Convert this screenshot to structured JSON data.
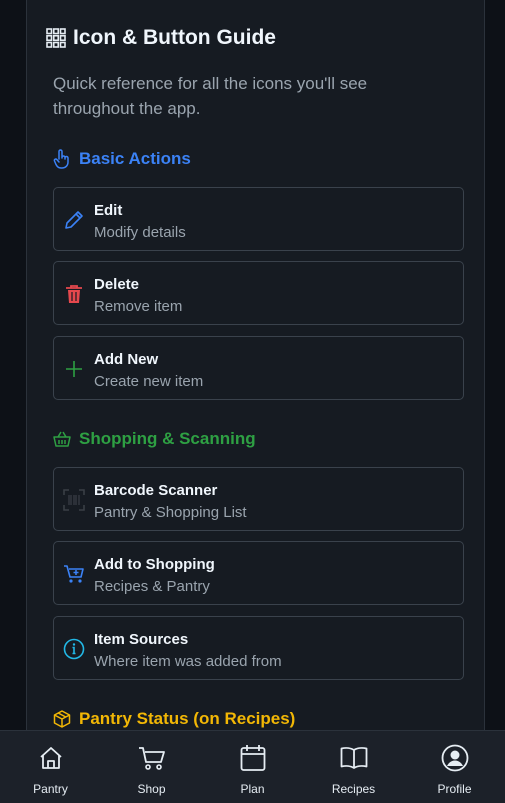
{
  "header": {
    "title": "Icon & Button Guide",
    "subtitle": "Quick reference for all the icons you'll see throughout the app."
  },
  "colors": {
    "blue": "#3b82f6",
    "green": "#2ea043",
    "red": "#e5484d",
    "amber": "#f2b705",
    "cyan": "#22b8e6"
  },
  "sections": [
    {
      "title": "Basic Actions",
      "icon": "hand-pointer-icon",
      "items": [
        {
          "title": "Edit",
          "desc": "Modify details",
          "icon": "pencil-icon"
        },
        {
          "title": "Delete",
          "desc": "Remove item",
          "icon": "trash-icon"
        },
        {
          "title": "Add New",
          "desc": "Create new item",
          "icon": "plus-icon"
        }
      ]
    },
    {
      "title": "Shopping & Scanning",
      "icon": "basket-icon",
      "items": [
        {
          "title": "Barcode Scanner",
          "desc": "Pantry & Shopping List",
          "icon": "barcode-icon"
        },
        {
          "title": "Add to Shopping",
          "desc": "Recipes & Pantry",
          "icon": "cart-plus-icon"
        },
        {
          "title": "Item Sources",
          "desc": "Where item was added from",
          "icon": "info-icon"
        }
      ]
    },
    {
      "title": "Pantry Status (on Recipes)",
      "icon": "box-icon",
      "items": []
    }
  ],
  "nav": [
    {
      "label": "Pantry",
      "icon": "home-icon"
    },
    {
      "label": "Shop",
      "icon": "cart-icon"
    },
    {
      "label": "Plan",
      "icon": "calendar-icon"
    },
    {
      "label": "Recipes",
      "icon": "book-icon"
    },
    {
      "label": "Profile",
      "icon": "user-circle-icon"
    }
  ]
}
